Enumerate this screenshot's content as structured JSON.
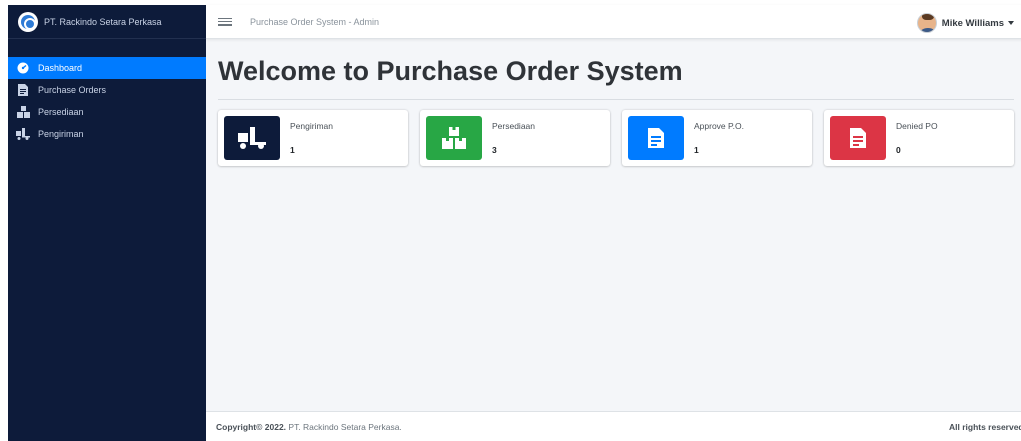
{
  "brand": {
    "name": "PT. Rackindo Setara Perkasa"
  },
  "sidebar": {
    "items": [
      {
        "label": "Dashboard",
        "icon": "dashboard-icon",
        "active": true
      },
      {
        "label": "Purchase Orders",
        "icon": "document-icon",
        "active": false
      },
      {
        "label": "Persediaan",
        "icon": "boxes-icon",
        "active": false
      },
      {
        "label": "Pengiriman",
        "icon": "truck-icon",
        "active": false
      }
    ]
  },
  "topbar": {
    "title": "Purchase Order System - Admin",
    "user_name": "Mike Williams"
  },
  "main": {
    "page_title": "Welcome to Purchase Order System",
    "cards": [
      {
        "label": "Pengiriman",
        "value": "1",
        "color": "#0d1b3a",
        "icon": "truck-icon"
      },
      {
        "label": "Persediaan",
        "value": "3",
        "color": "#28a745",
        "icon": "boxes-icon"
      },
      {
        "label": "Approve P.O.",
        "value": "1",
        "color": "#007bff",
        "icon": "file-icon"
      },
      {
        "label": "Denied PO",
        "value": "0",
        "color": "#dc3545",
        "icon": "file-icon"
      }
    ]
  },
  "footer": {
    "copyright": "Copyright© 2022.",
    "company": "PT. Rackindo Setara Perkasa.",
    "rights": "All rights reserved."
  },
  "colors": {
    "sidebar_bg": "#0d1b3a",
    "accent": "#007bff",
    "content_bg": "#f4f6f9"
  }
}
